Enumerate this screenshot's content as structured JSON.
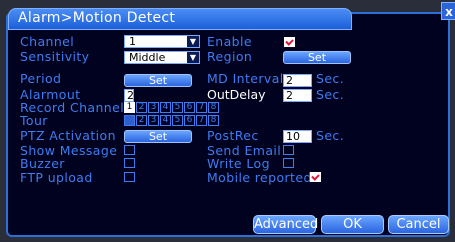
{
  "window": {
    "title": "Alarm>Motion Detect",
    "close_glyph": "x"
  },
  "fields": {
    "channel": {
      "label": "Channel",
      "value": "1"
    },
    "sensitivity": {
      "label": "Sensitivity",
      "value": "Middle"
    },
    "enable": {
      "label": "Enable",
      "checked": true
    },
    "region": {
      "label": "Region",
      "button": "Set"
    },
    "period": {
      "label": "Period",
      "button": "Set"
    },
    "md_interval": {
      "label": "MD Interval",
      "value": "2",
      "unit": "Sec."
    },
    "alarmout": {
      "label": "Alarmout",
      "value": "2"
    },
    "outdelay": {
      "label": "OutDelay",
      "value": "2",
      "unit": "Sec."
    },
    "record_channel": {
      "label": "Record Channel",
      "channels": [
        "1",
        "2",
        "3",
        "4",
        "5",
        "6",
        "7",
        "8"
      ],
      "selected": [
        1
      ]
    },
    "tour": {
      "label": "Tour",
      "channels": [
        "1",
        "2",
        "3",
        "4",
        "5",
        "6",
        "7",
        "8"
      ],
      "dimmed": [
        1
      ]
    },
    "ptz_activation": {
      "label": "PTZ Activation",
      "button": "Set"
    },
    "postrec": {
      "label": "PostRec",
      "value": "10",
      "unit": "Sec."
    },
    "show_message": {
      "label": "Show Message",
      "checked": false
    },
    "send_email": {
      "label": "Send Email",
      "checked": false
    },
    "buzzer": {
      "label": "Buzzer",
      "checked": false
    },
    "write_log": {
      "label": "Write Log",
      "checked": false
    },
    "ftp_upload": {
      "label": "FTP upload",
      "checked": false
    },
    "mobile_reported": {
      "label": "Mobile reported",
      "checked": true
    }
  },
  "buttons": {
    "advanced": "Advanced",
    "ok": "OK",
    "cancel": "Cancel"
  },
  "colors": {
    "label_blue": "#3e7cf2",
    "panel_bg": "#01021f",
    "button_blue": "#2b64e0",
    "check_red": "#e0143c"
  }
}
